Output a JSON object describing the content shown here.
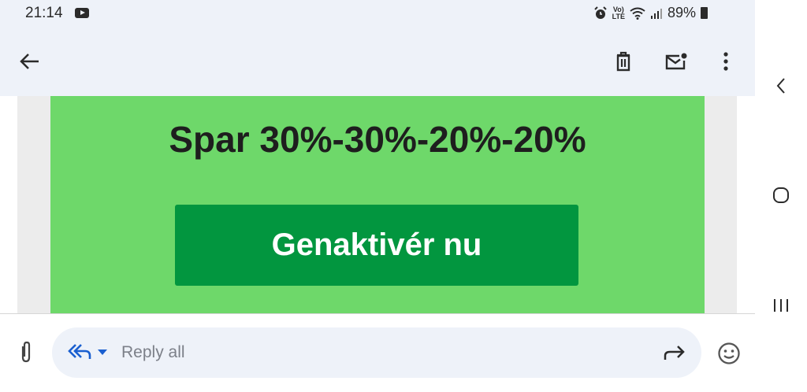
{
  "status": {
    "time": "21:14",
    "battery": "89%",
    "volte_top": "Vo)",
    "volte_bottom": "LTE"
  },
  "toolbar": {
    "back": "back-arrow-icon",
    "delete": "trash-icon",
    "mark_unread": "mail-unread-icon",
    "more": "more-vert-icon"
  },
  "email": {
    "promo_title": "Spar 30%-30%-20%-20%",
    "button_label": "Genaktivér nu",
    "colors": {
      "banner": "#6ed86a",
      "button": "#02963f"
    }
  },
  "compose": {
    "placeholder": "Reply all"
  },
  "navbar": [
    "back-icon",
    "home-icon",
    "recents-icon"
  ]
}
